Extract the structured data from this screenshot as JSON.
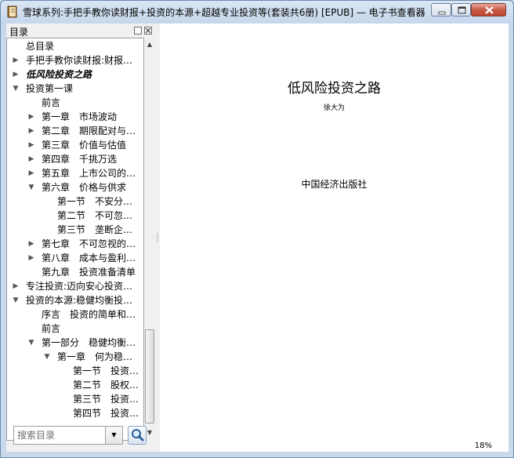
{
  "window": {
    "title": "雪球系列:手把手教你读财报+投资的本源+超越专业投资等(套装共6册) [EPUB] — 电子书查看器"
  },
  "sidebar": {
    "title": "目录",
    "items": [
      {
        "label": "总目录",
        "arrow": ""
      },
      {
        "label": "手把手教你读财报:财报…",
        "arrow": "▶"
      },
      {
        "label": "低风险投资之路",
        "arrow": "▶"
      },
      {
        "label": "投资第一课",
        "arrow": "▼"
      },
      {
        "label": "前言",
        "arrow": ""
      },
      {
        "label": "第一章　市场波动",
        "arrow": "▶"
      },
      {
        "label": "第二章　期限配对与…",
        "arrow": "▶"
      },
      {
        "label": "第三章　价值与估值",
        "arrow": "▶"
      },
      {
        "label": "第四章　千挑万选",
        "arrow": "▶"
      },
      {
        "label": "第五章　上市公司的…",
        "arrow": "▶"
      },
      {
        "label": "第六章　价格与供求",
        "arrow": "▼"
      },
      {
        "label": "第一节　不安分…",
        "arrow": ""
      },
      {
        "label": "第二节　不可忽…",
        "arrow": ""
      },
      {
        "label": "第三节　垄断企…",
        "arrow": ""
      },
      {
        "label": "第七章　不可忽视的…",
        "arrow": "▶"
      },
      {
        "label": "第八章　成本与盈利…",
        "arrow": "▶"
      },
      {
        "label": "第九章　投资准备清单",
        "arrow": ""
      },
      {
        "label": "专注投资:迈向安心投资…",
        "arrow": "▶"
      },
      {
        "label": "投资的本源:稳健均衡投…",
        "arrow": "▼"
      },
      {
        "label": "序言　投资的简单和…",
        "arrow": ""
      },
      {
        "label": "前言",
        "arrow": ""
      },
      {
        "label": "第一部分　稳健均衡…",
        "arrow": "▼"
      },
      {
        "label": "第一章　何为稳…",
        "arrow": "▼"
      },
      {
        "label": "第一节　投资…",
        "arrow": ""
      },
      {
        "label": "第二节　股权…",
        "arrow": ""
      },
      {
        "label": "第三节　投资…",
        "arrow": ""
      },
      {
        "label": "第四节　投资…",
        "arrow": ""
      }
    ],
    "search": {
      "placeholder": "搜索目录"
    }
  },
  "content": {
    "title": "低风险投资之路",
    "author": "徐大为",
    "publisher": "中国经济出版社",
    "progress": "18%"
  }
}
